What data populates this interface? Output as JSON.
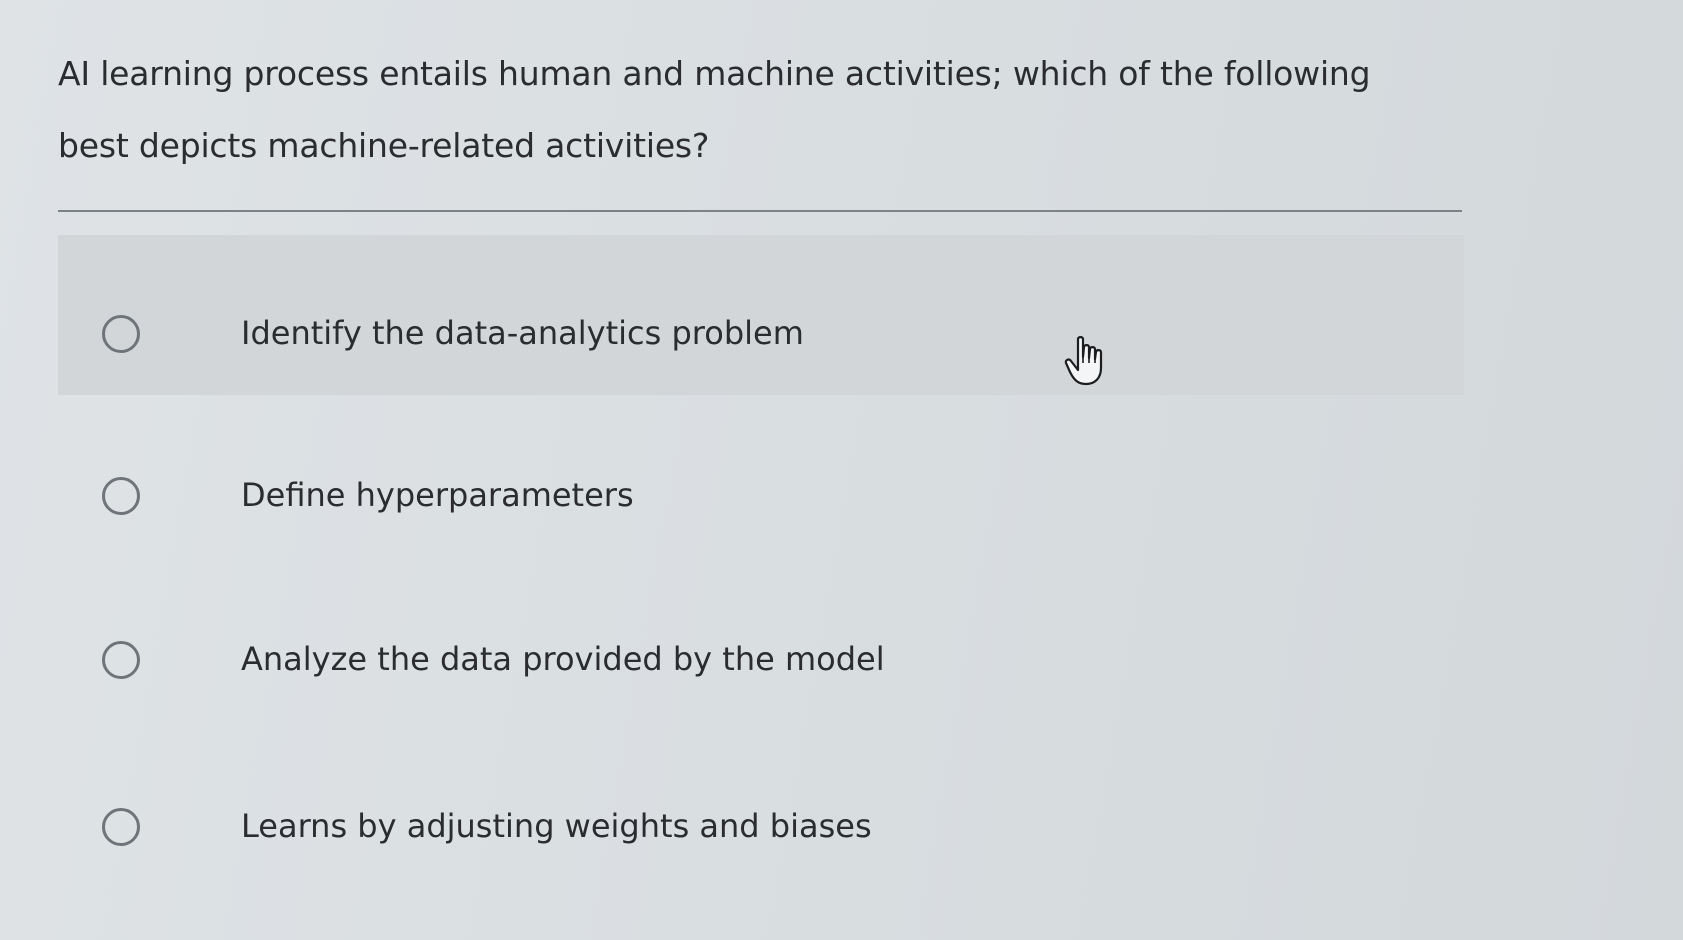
{
  "question": {
    "text": "AI learning process entails human and machine activities; which of the following best depicts machine-related activities?"
  },
  "options": [
    {
      "label": "Identify the data-analytics problem",
      "selected": false
    },
    {
      "label": "Define hyperparameters",
      "selected": false
    },
    {
      "label": "Analyze the data provided by the model",
      "selected": false
    },
    {
      "label": "Learns by adjusting weights and biases",
      "selected": false
    }
  ],
  "cursor": {
    "icon": "hand-pointer-icon"
  }
}
